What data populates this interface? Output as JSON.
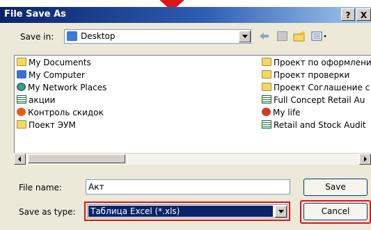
{
  "dialog": {
    "title": "File Save As",
    "help_label": "?",
    "close_label": "X"
  },
  "toolbar": {
    "save_in_label": "Save in:",
    "save_in_value": "Desktop"
  },
  "files": {
    "left": [
      {
        "label": "My Documents",
        "icon": "folder-icon"
      },
      {
        "label": "My Computer",
        "icon": "computer-icon"
      },
      {
        "label": "My Network Places",
        "icon": "network-icon"
      },
      {
        "label": "акции",
        "icon": "spreadsheet-icon"
      },
      {
        "label": "Контроль скидок",
        "icon": "app-icon"
      },
      {
        "label": "Поект ЭУМ",
        "icon": "folder-icon"
      }
    ],
    "right": [
      {
        "label": "Проект по оформлени",
        "icon": "folder-icon"
      },
      {
        "label": "Проект проверки",
        "icon": "folder-icon"
      },
      {
        "label": "Проект Соглашение с",
        "icon": "folder-icon"
      },
      {
        "label": "Full Concept Retail Au",
        "icon": "spreadsheet-icon"
      },
      {
        "label": "My life",
        "icon": "no-entry-icon"
      },
      {
        "label": "Retail and Stock Audit",
        "icon": "spreadsheet-icon"
      }
    ]
  },
  "form": {
    "file_name_label": "File name:",
    "file_name_value": "Акт",
    "save_as_type_label": "Save as type:",
    "save_as_type_value": "Таблица Excel (*.xls)",
    "save_label": "Save",
    "cancel_label": "Cancel"
  },
  "colors": {
    "accent_red": "#e0121a",
    "titlebar": "#0a246a"
  }
}
